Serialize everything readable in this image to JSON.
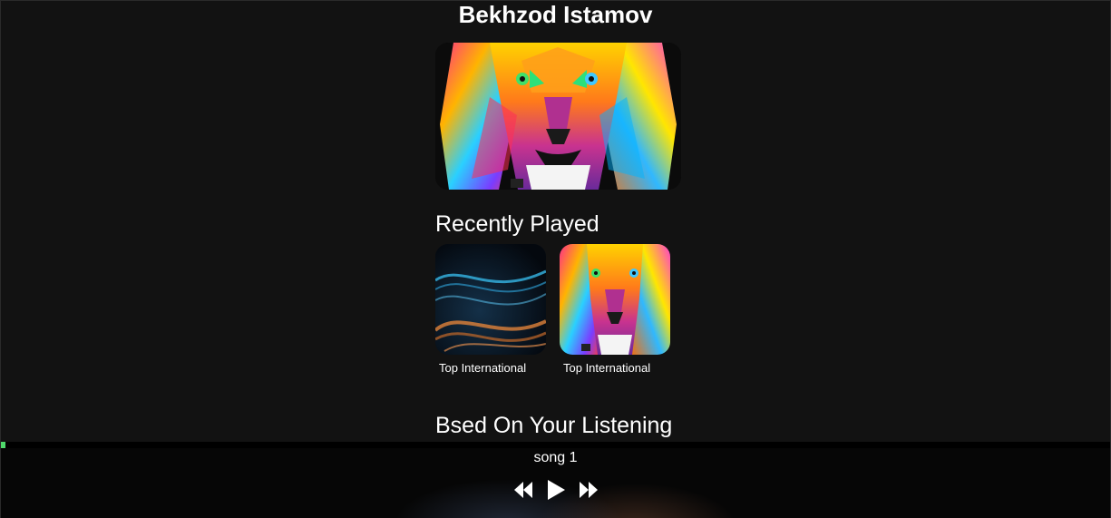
{
  "artist": {
    "name": "Bekhzod Istamov"
  },
  "hero": {
    "image": "lion-artwork"
  },
  "sections": {
    "recently_played": "Recently Played",
    "based_on": "Bsed On Your Listening"
  },
  "recent": [
    {
      "title": "Top International",
      "image": "particle-wave-artwork"
    },
    {
      "title": "Top International",
      "image": "lion-artwork"
    }
  ],
  "player": {
    "song": "song 1",
    "progress": 0.004,
    "accent": "#4fd96b"
  }
}
